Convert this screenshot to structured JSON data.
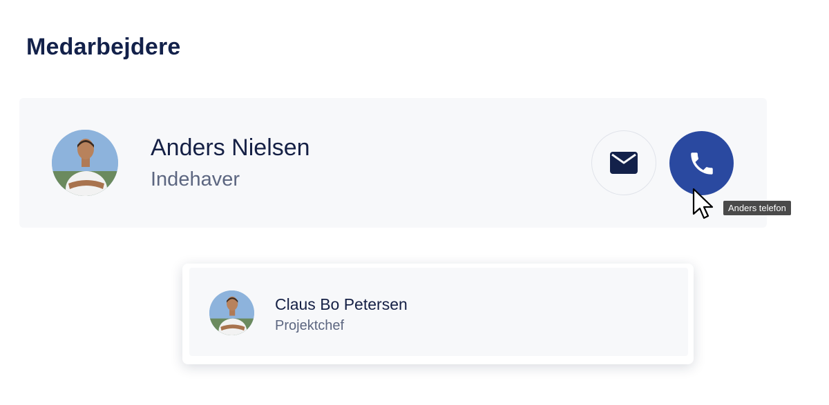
{
  "page": {
    "title": "Medarbejdere"
  },
  "employees": [
    {
      "name": "Anders Nielsen",
      "role": "Indehaver",
      "email_icon": "envelope-icon",
      "phone_icon": "phone-icon"
    },
    {
      "name": "Claus Bo Petersen",
      "role": "Projektchef"
    }
  ],
  "tooltip": {
    "text": "Anders telefon"
  },
  "colors": {
    "title": "#13214a",
    "card_background": "#f7f8fa",
    "phone_button": "#2a49a0",
    "secondary_text": "#5c6680",
    "tooltip_background": "#4a4a4a"
  }
}
